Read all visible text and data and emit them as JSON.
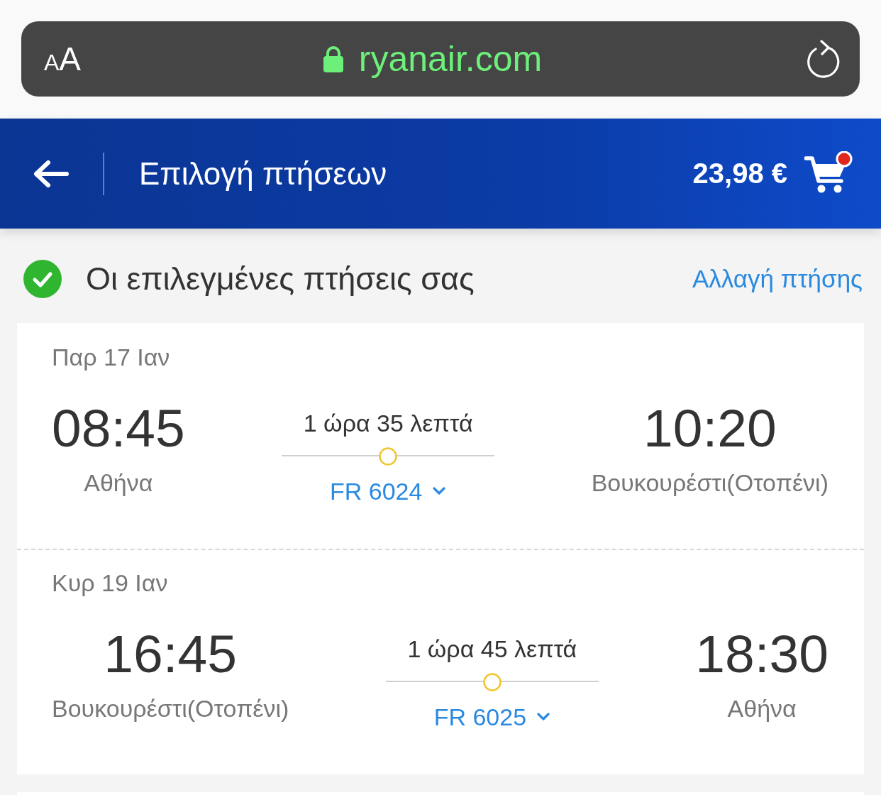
{
  "browser_bar": {
    "text_size_button": {
      "small": "A",
      "large": "A"
    },
    "secure": true,
    "url": "ryanair.com"
  },
  "header": {
    "title": "Επιλογή πτήσεων",
    "price": "23,98 €",
    "cart_badge": true
  },
  "selection": {
    "confirmed": true,
    "title": "Οι επιλεγμένες πτήσεις σας",
    "change_link": "Αλλαγή πτήσης"
  },
  "flights": [
    {
      "date": "Παρ 17 Ιαν",
      "departure": {
        "time": "08:45",
        "city": "Αθήνα"
      },
      "duration": "1 ώρα 35 λεπτά",
      "flight_number": "FR 6024",
      "arrival": {
        "time": "10:20",
        "city": "Βουκουρέστι(Οτοπένι)"
      }
    },
    {
      "date": "Κυρ 19 Ιαν",
      "departure": {
        "time": "16:45",
        "city": "Βουκουρέστι(Οτοπένι)"
      },
      "duration": "1 ώρα 45 λεπτά",
      "flight_number": "FR 6025",
      "arrival": {
        "time": "18:30",
        "city": "Αθήνα"
      }
    }
  ]
}
